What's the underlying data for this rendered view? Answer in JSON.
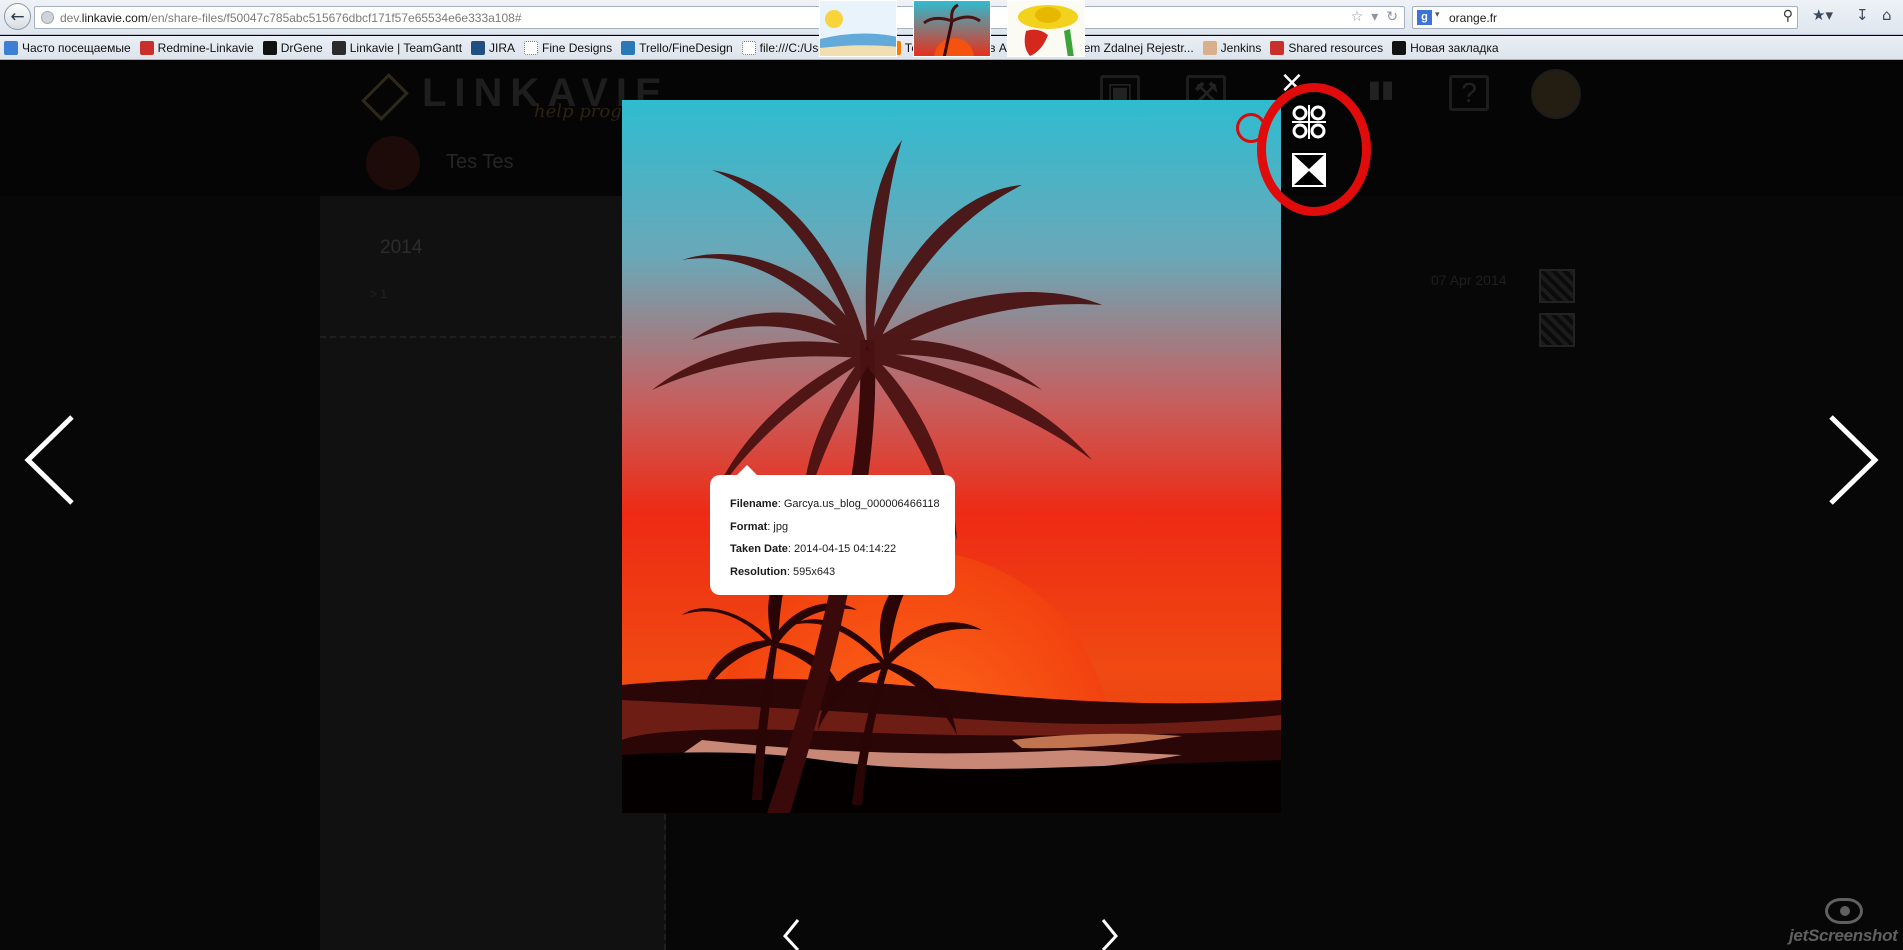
{
  "browser": {
    "url_prefix": "dev.",
    "url_domain": "linkavie.com",
    "url_path": "/en/share-files/f50047c785abc515676dbcf171f57e65534e6e333a108#",
    "search_text": "orange.fr",
    "search_engine_letter": "g"
  },
  "bookmarks": [
    {
      "label": "Часто посещаемые",
      "icon": "folder-icon",
      "color": "#3d7fd6"
    },
    {
      "label": "Redmine-Linkavie",
      "icon": "redmine-icon",
      "color": "#c9302c"
    },
    {
      "label": "DrGene",
      "icon": "drgene-icon",
      "color": "#111111"
    },
    {
      "label": "Linkavie | TeamGantt",
      "icon": "teamgantt-icon",
      "color": "#2b2b2b"
    },
    {
      "label": "JIRA",
      "icon": "jira-icon",
      "color": "#205081"
    },
    {
      "label": "Fine Designs",
      "icon": "page-icon",
      "color": "#ffffff"
    },
    {
      "label": "Trello/FineDesign",
      "icon": "trello-icon",
      "color": "#2b78b7"
    },
    {
      "label": "file:///C:/Users/PM/A...",
      "icon": "page-icon",
      "color": "#ffffff"
    },
    {
      "label": "Тем временем в Авст...",
      "icon": "blogger-icon",
      "color": "#f57d00"
    },
    {
      "label": "System Zdalnej Rejestr...",
      "icon": "flag-pl-icon",
      "color": "#dc143c"
    },
    {
      "label": "Jenkins",
      "icon": "jenkins-icon",
      "color": "#d8b18c"
    },
    {
      "label": "Shared resources",
      "icon": "redmine-icon",
      "color": "#c9302c"
    },
    {
      "label": "Новая закладка",
      "icon": "github-icon",
      "color": "#111111"
    }
  ],
  "page": {
    "logo_text": "LINKAVIE",
    "logo_tagline": "help program",
    "user_name": "Tes Tes",
    "year": "2014",
    "count": "> 1",
    "date": "07 Apr 2014"
  },
  "lightbox": {
    "close_glyph": "×",
    "info": {
      "filename_label": "Filename",
      "filename_value": "Garcya.us_blog_000006466118",
      "format_label": "Format",
      "format_value": "jpg",
      "taken_label": "Taken Date",
      "taken_value": "2014-04-15 04:14:22",
      "resolution_label": "Resolution",
      "resolution_value": "595x643"
    },
    "thumbnails": [
      "summer-beach-thumbnail",
      "palm-sunset-thumbnail",
      "mexican-chili-thumbnail"
    ],
    "selected_thumbnail_index": 1
  },
  "watermark": {
    "text": "jetScreenshot"
  },
  "colors": {
    "annotation_red": "#e00b0b",
    "sky_top": "#2fbcd0",
    "sunset_red": "#ee2a14",
    "sun_orange": "#f5520f"
  }
}
